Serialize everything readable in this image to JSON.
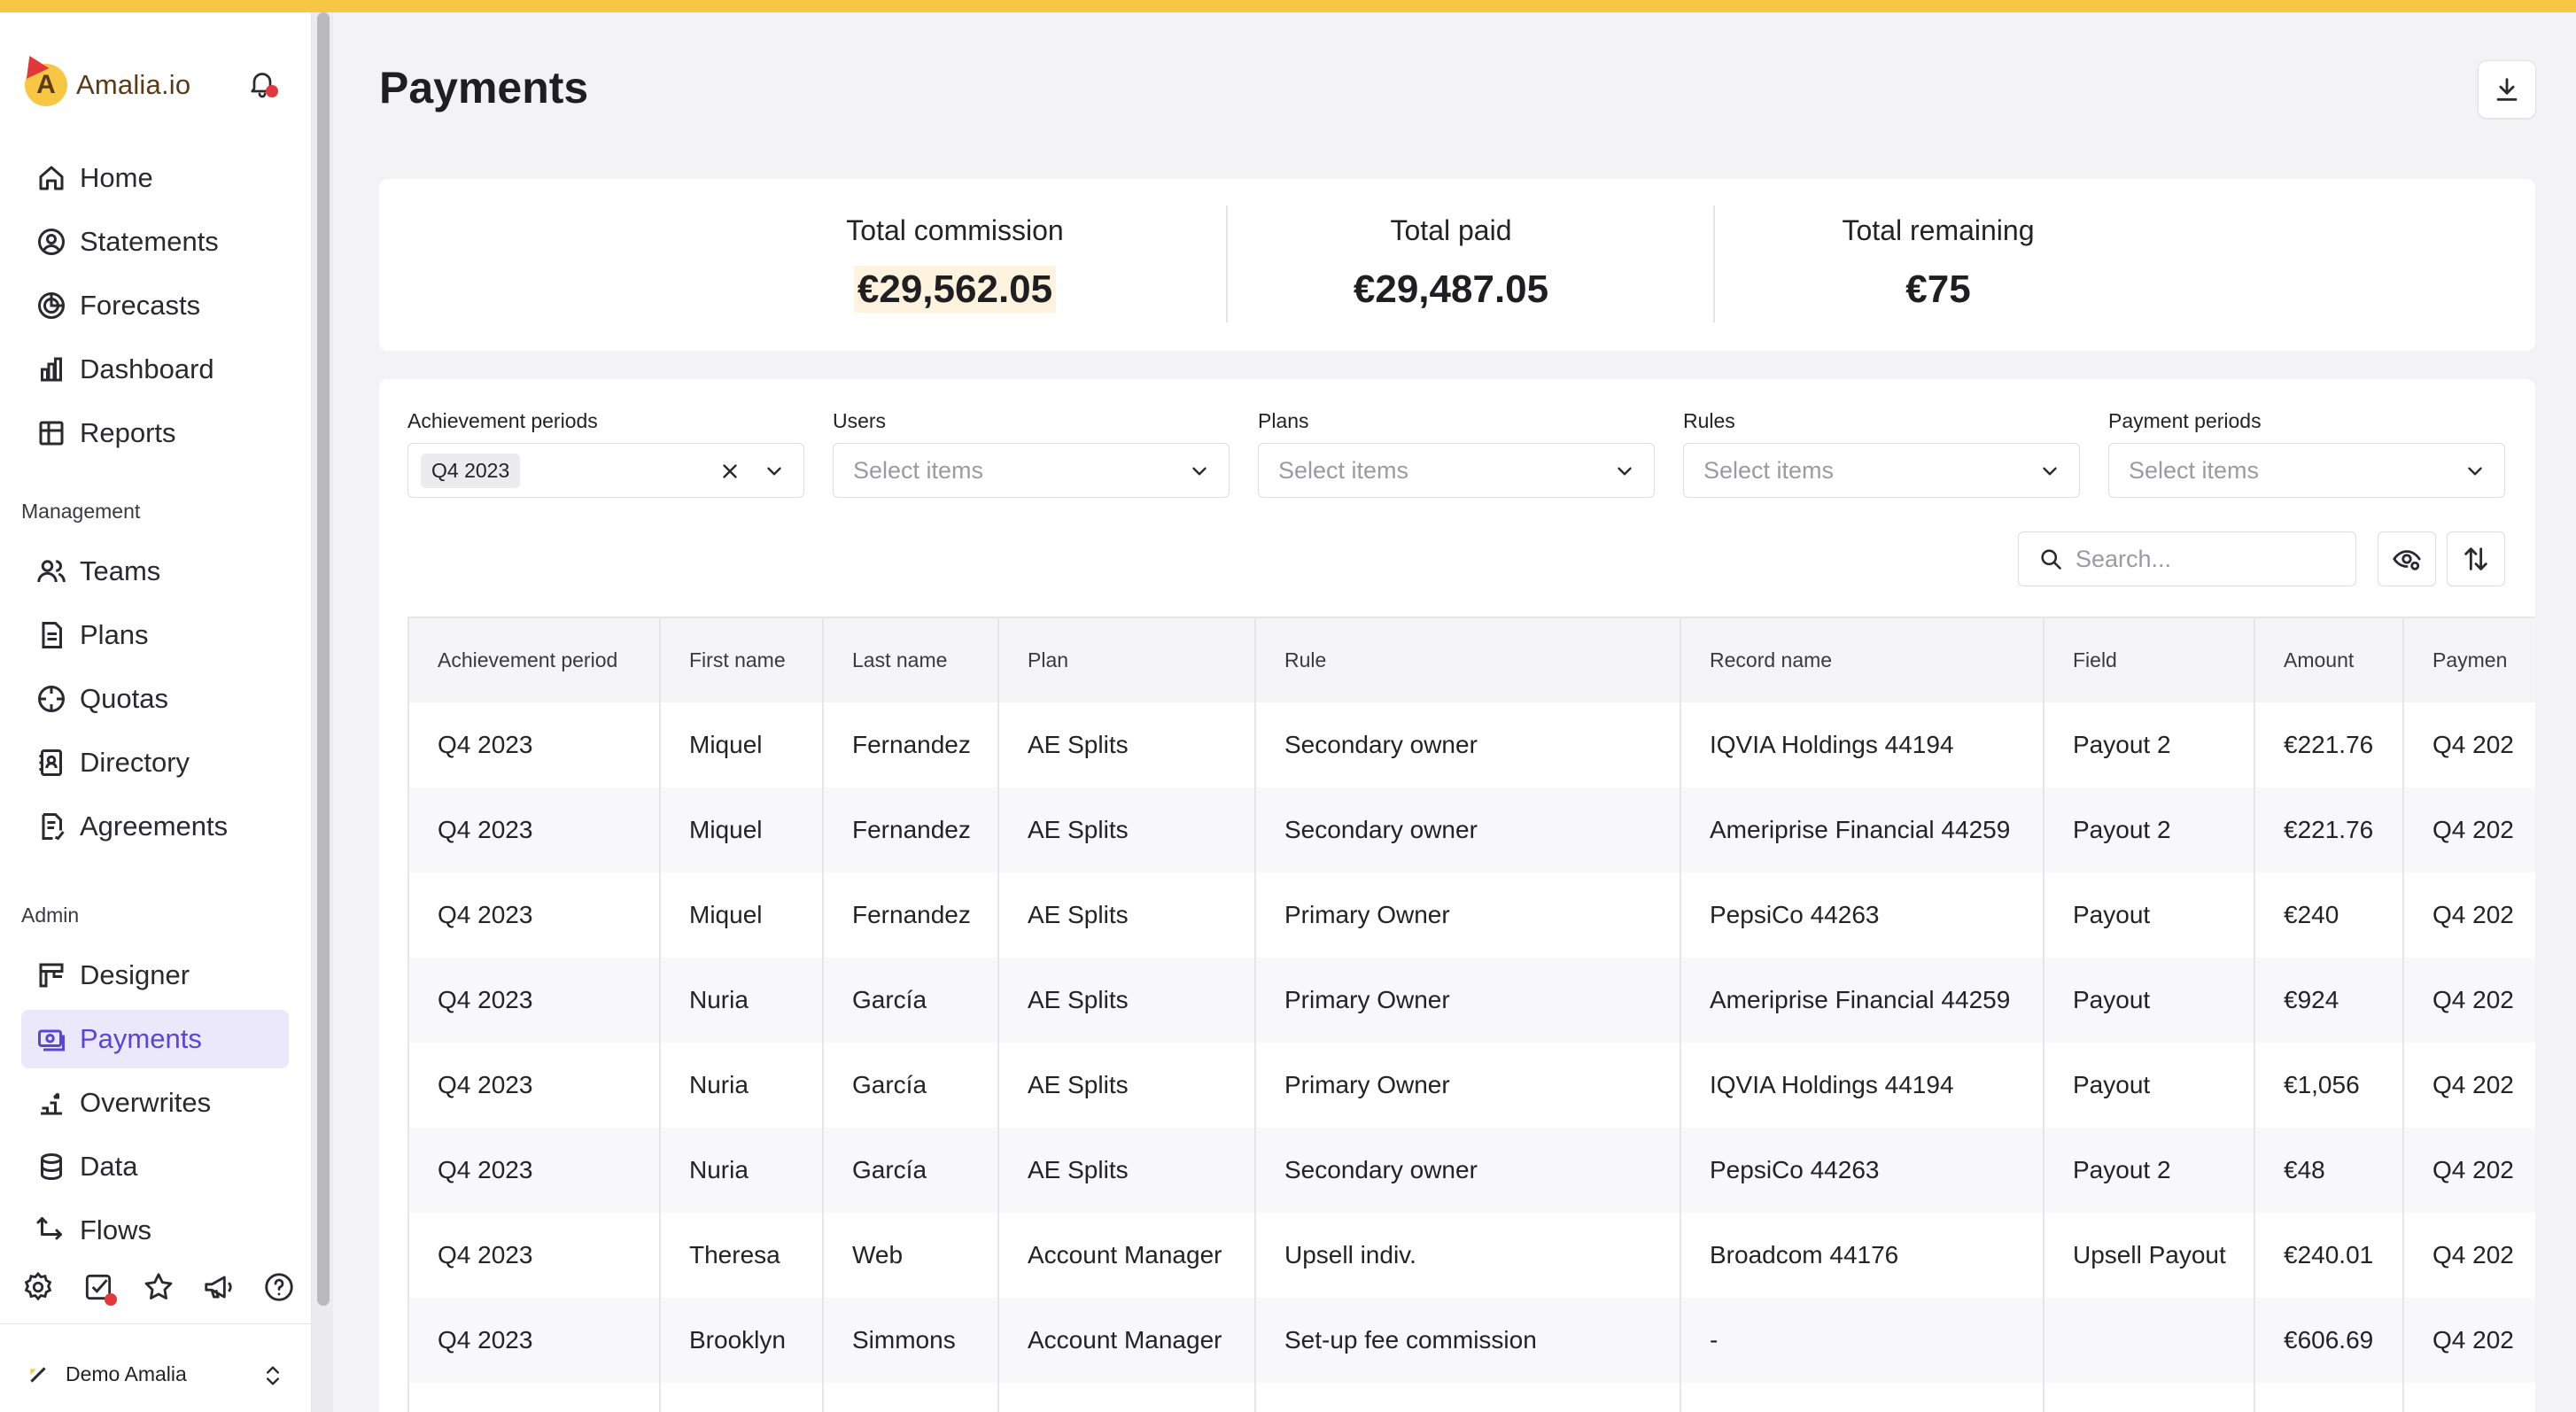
{
  "app": {
    "brand": "Amalia.io",
    "accent_color": "#5a45d6",
    "top_strip_color": "#f7c744"
  },
  "sidebar": {
    "main_items": [
      {
        "label": "Home",
        "icon": "home-icon"
      },
      {
        "label": "Statements",
        "icon": "user-circle-icon"
      },
      {
        "label": "Forecasts",
        "icon": "forecast-icon"
      },
      {
        "label": "Dashboard",
        "icon": "bar-chart-icon"
      },
      {
        "label": "Reports",
        "icon": "table-icon"
      }
    ],
    "management_title": "Management",
    "management_items": [
      {
        "label": "Teams",
        "icon": "users-icon"
      },
      {
        "label": "Plans",
        "icon": "document-icon"
      },
      {
        "label": "Quotas",
        "icon": "target-icon"
      },
      {
        "label": "Directory",
        "icon": "contact-book-icon"
      },
      {
        "label": "Agreements",
        "icon": "agreement-icon"
      }
    ],
    "admin_title": "Admin",
    "admin_items": [
      {
        "label": "Designer",
        "icon": "designer-icon"
      },
      {
        "label": "Payments",
        "icon": "payments-icon",
        "active": true
      },
      {
        "label": "Overwrites",
        "icon": "overwrite-icon"
      },
      {
        "label": "Data",
        "icon": "database-icon"
      },
      {
        "label": "Flows",
        "icon": "flow-icon"
      }
    ],
    "workspace": "Demo Amalia"
  },
  "page": {
    "title": "Payments"
  },
  "totals": {
    "commission_label": "Total commission",
    "commission_value": "€29,562.05",
    "paid_label": "Total paid",
    "paid_value": "€29,487.05",
    "remaining_label": "Total remaining",
    "remaining_value": "€75"
  },
  "filters": {
    "achievement_label": "Achievement periods",
    "achievement_selected": "Q4 2023",
    "users_label": "Users",
    "plans_label": "Plans",
    "rules_label": "Rules",
    "payment_periods_label": "Payment periods",
    "placeholder": "Select items"
  },
  "search": {
    "placeholder": "Search..."
  },
  "table": {
    "columns": [
      "Achievement period",
      "First name",
      "Last name",
      "Plan",
      "Rule",
      "Record name",
      "Field",
      "Amount",
      "Paymen"
    ],
    "rows": [
      [
        "Q4 2023",
        "Miquel",
        "Fernandez",
        "AE Splits",
        "Secondary owner",
        "IQVIA Holdings 44194",
        "Payout 2",
        "€221.76",
        "Q4 202"
      ],
      [
        "Q4 2023",
        "Miquel",
        "Fernandez",
        "AE Splits",
        "Secondary owner",
        "Ameriprise Financial 44259",
        "Payout 2",
        "€221.76",
        "Q4 202"
      ],
      [
        "Q4 2023",
        "Miquel",
        "Fernandez",
        "AE Splits",
        "Primary Owner",
        "PepsiCo 44263",
        "Payout",
        "€240",
        "Q4 202"
      ],
      [
        "Q4 2023",
        "Nuria",
        "García",
        "AE Splits",
        "Primary Owner",
        "Ameriprise Financial 44259",
        "Payout",
        "€924",
        "Q4 202"
      ],
      [
        "Q4 2023",
        "Nuria",
        "García",
        "AE Splits",
        "Primary Owner",
        "IQVIA Holdings 44194",
        "Payout",
        "€1,056",
        "Q4 202"
      ],
      [
        "Q4 2023",
        "Nuria",
        "García",
        "AE Splits",
        "Secondary owner",
        "PepsiCo 44263",
        "Payout 2",
        "€48",
        "Q4 202"
      ],
      [
        "Q4 2023",
        "Theresa",
        "Web",
        "Account Manager",
        "Upsell indiv.",
        "Broadcom 44176",
        "Upsell Payout",
        "€240.01",
        "Q4 202"
      ],
      [
        "Q4 2023",
        "Brooklyn",
        "Simmons",
        "Account Manager",
        "Set-up fee commission",
        "-",
        "",
        "€606.69",
        "Q4 202"
      ],
      [
        "",
        "",
        "",
        "",
        "",
        "",
        "",
        "",
        ""
      ]
    ]
  }
}
